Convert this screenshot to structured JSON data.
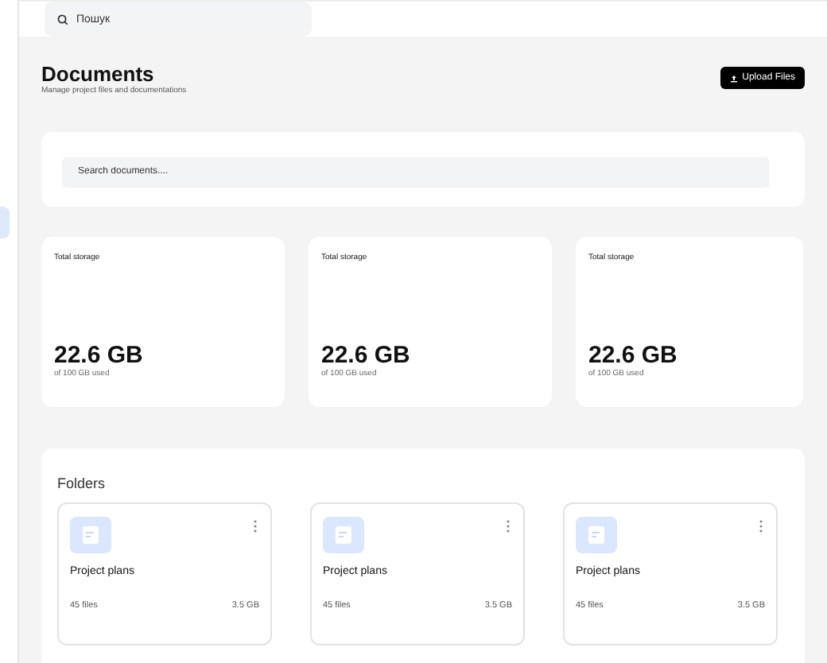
{
  "header": {
    "search": {
      "placeholder": "Пошук"
    }
  },
  "page": {
    "title": "Documents",
    "subtitle": "Manage project files and documentations",
    "upload_button": "Upload Files"
  },
  "document_search": {
    "placeholder": "Search documents...."
  },
  "stats": [
    {
      "label": "Total storage",
      "value": "22.6 GB",
      "note": "of 100 GB used"
    },
    {
      "label": "Total storage",
      "value": "22.6 GB",
      "note": "of 100 GB used"
    },
    {
      "label": "Total storage",
      "value": "22.6 GB",
      "note": "of 100 GB used"
    }
  ],
  "folders": {
    "title": "Folders",
    "items": [
      {
        "name": "Project plans",
        "files": "45 files",
        "size": "3.5 GB"
      },
      {
        "name": "Project plans",
        "files": "45 files",
        "size": "3.5 GB"
      },
      {
        "name": "Project plans",
        "files": "45 files",
        "size": "3.5 GB"
      }
    ]
  }
}
